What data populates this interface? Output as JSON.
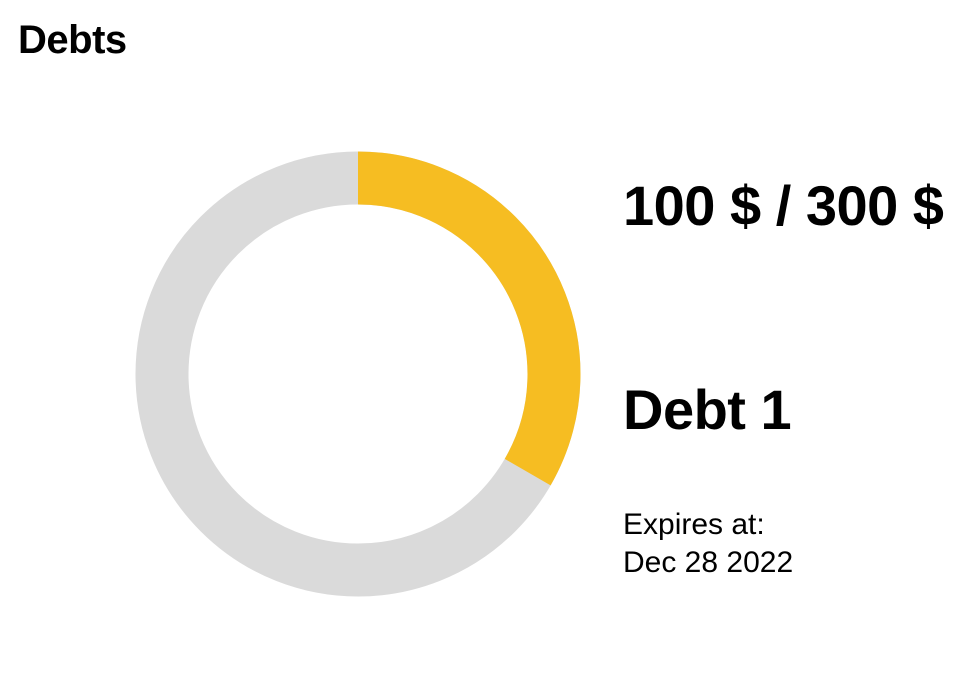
{
  "page": {
    "title": "Debts"
  },
  "debt": {
    "amount_text": "100 $ / 300 $",
    "paid": 100,
    "total": 300,
    "name": "Debt 1",
    "expires_label": "Expires at:",
    "expires_date": "Dec 28 2022"
  },
  "colors": {
    "progress": "#F6BD22",
    "track": "#DADADA"
  }
}
